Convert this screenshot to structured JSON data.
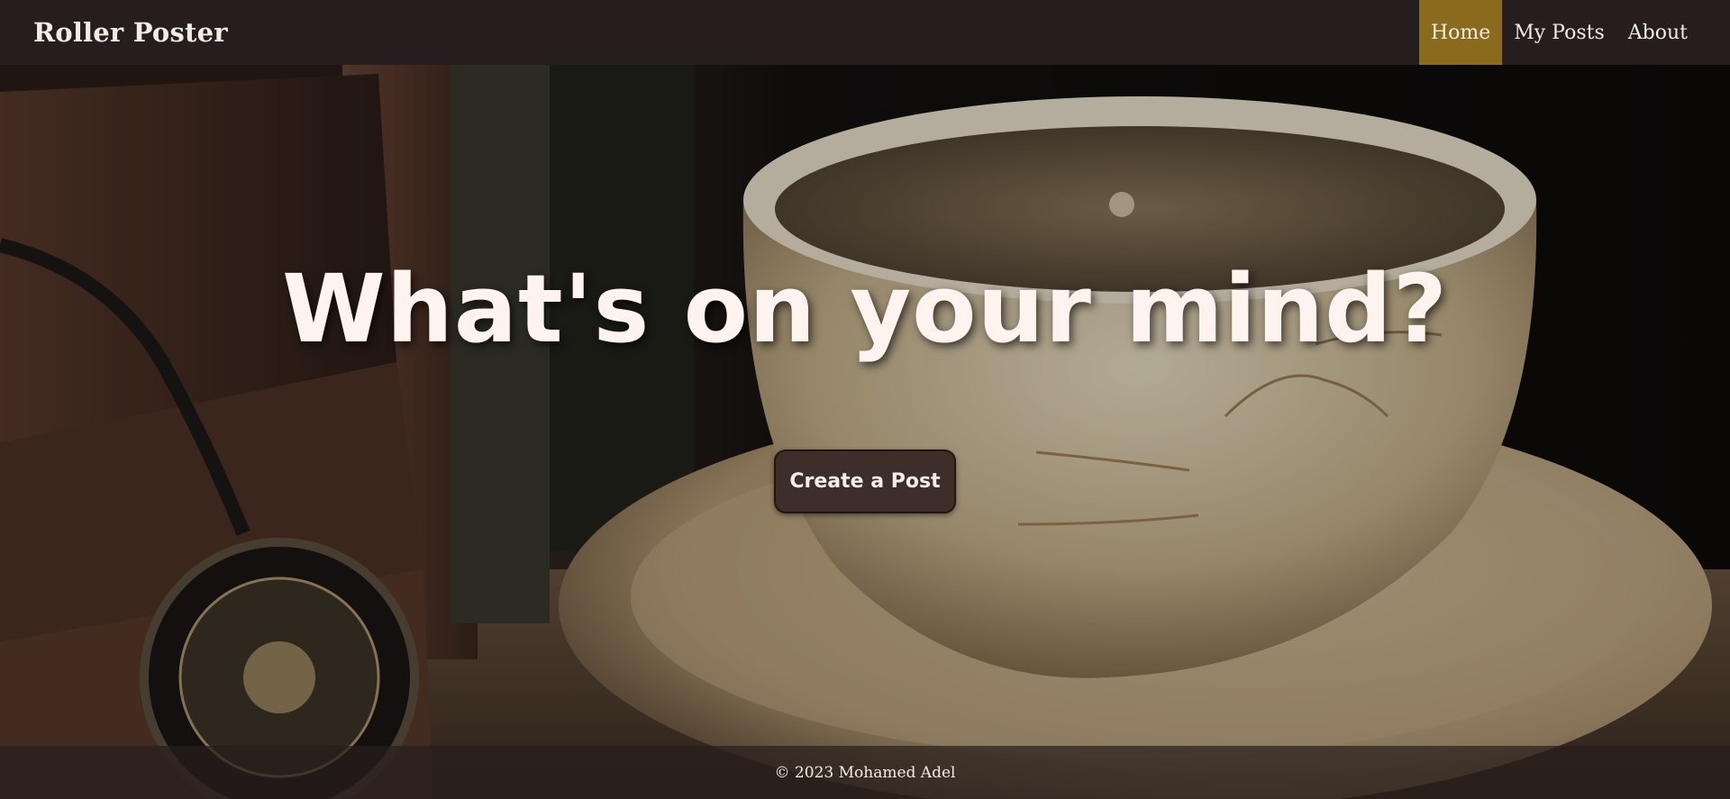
{
  "nav": {
    "brand": "Roller Poster",
    "links": [
      {
        "label": "Home",
        "active": true
      },
      {
        "label": "My Posts",
        "active": false
      },
      {
        "label": "About",
        "active": false
      }
    ],
    "active_color": "#8a6a1c",
    "bar_color": "#261e1e"
  },
  "hero": {
    "title": "What's on your mind?",
    "cta_label": "Create a Post",
    "background_image": "vintage-books-pocket-watch-tea-cup"
  },
  "footer": {
    "text": "© 2023 Mohamed Adel"
  }
}
